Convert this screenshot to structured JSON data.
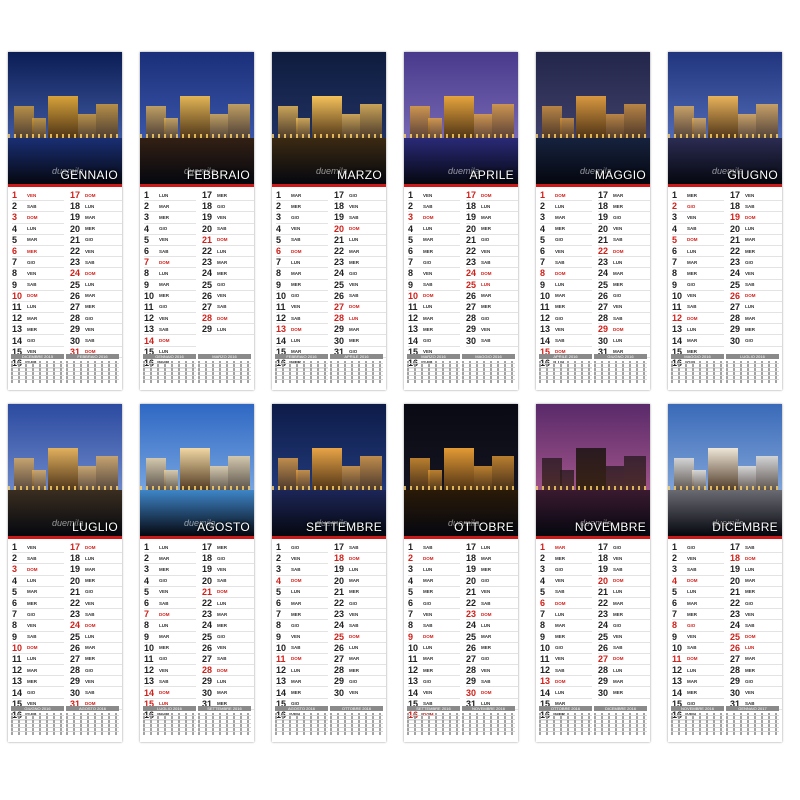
{
  "brand": "duemila",
  "months": [
    {
      "name": "GENNAIO",
      "sky": [
        "#0b1d55",
        "#5a78c6"
      ],
      "water": "#1a2f74",
      "tower": "#d8a23a",
      "mini": [
        "DICEMBRE 2015",
        "FEBBRAIO 2016"
      ],
      "days": [
        "VEN",
        "SAB",
        "DOM",
        "LUN",
        "MAR",
        "MER",
        "GIO",
        "VEN",
        "SAB",
        "DOM",
        "LUN",
        "MAR",
        "MER",
        "GIO",
        "VEN",
        "SAB",
        "DOM",
        "LUN",
        "MAR",
        "MER",
        "GIO",
        "VEN",
        "SAB",
        "DOM",
        "LUN",
        "MAR",
        "MER",
        "GIO",
        "VEN",
        "SAB",
        "DOM"
      ],
      "hol": [
        1,
        3,
        6,
        10,
        17,
        24,
        31
      ]
    },
    {
      "name": "FEBBRAIO",
      "sky": [
        "#1b2f7a",
        "#4a6ac0"
      ],
      "water": "#332014",
      "tower": "#e2b456",
      "mini": [
        "GENNAIO 2016",
        "MARZO 2016"
      ],
      "days": [
        "LUN",
        "MAR",
        "MER",
        "GIO",
        "VEN",
        "SAB",
        "DOM",
        "LUN",
        "MAR",
        "MER",
        "GIO",
        "VEN",
        "SAB",
        "DOM",
        "LUN",
        "MAR",
        "MER",
        "GIO",
        "VEN",
        "SAB",
        "DOM",
        "LUN",
        "MAR",
        "MER",
        "GIO",
        "VEN",
        "SAB",
        "DOM",
        "LUN"
      ],
      "hol": [
        7,
        14,
        21,
        28
      ]
    },
    {
      "name": "MARZO",
      "sky": [
        "#0e1c3e",
        "#2a3d74"
      ],
      "water": "#3b2a12",
      "tower": "#f4c15a",
      "mini": [
        "FEBBRAIO 2016",
        "APRILE 2016"
      ],
      "days": [
        "MAR",
        "MER",
        "GIO",
        "VEN",
        "SAB",
        "DOM",
        "LUN",
        "MAR",
        "MER",
        "GIO",
        "VEN",
        "SAB",
        "DOM",
        "LUN",
        "MAR",
        "MER",
        "GIO",
        "VEN",
        "SAB",
        "DOM",
        "LUN",
        "MAR",
        "MER",
        "GIO",
        "VEN",
        "SAB",
        "DOM",
        "LUN",
        "MAR",
        "MER",
        "GIO"
      ],
      "hol": [
        6,
        13,
        20,
        27,
        28
      ]
    },
    {
      "name": "APRILE",
      "sky": [
        "#4a3a8c",
        "#8d7fc8"
      ],
      "water": "#2a2a78",
      "tower": "#e6a43c",
      "mini": [
        "MARZO 2016",
        "MAGGIO 2016"
      ],
      "days": [
        "VEN",
        "SAB",
        "DOM",
        "LUN",
        "MAR",
        "MER",
        "GIO",
        "VEN",
        "SAB",
        "DOM",
        "LUN",
        "MAR",
        "MER",
        "GIO",
        "VEN",
        "SAB",
        "DOM",
        "LUN",
        "MAR",
        "MER",
        "GIO",
        "VEN",
        "SAB",
        "DOM",
        "LUN",
        "MAR",
        "MER",
        "GIO",
        "VEN",
        "SAB"
      ],
      "hol": [
        3,
        10,
        17,
        24,
        25
      ]
    },
    {
      "name": "MAGGIO",
      "sky": [
        "#23264a",
        "#4e4e7a"
      ],
      "water": "#16223e",
      "tower": "#d89840",
      "mini": [
        "APRILE 2016",
        "GIUGNO 2016"
      ],
      "days": [
        "DOM",
        "LUN",
        "MAR",
        "MER",
        "GIO",
        "VEN",
        "SAB",
        "DOM",
        "LUN",
        "MAR",
        "MER",
        "GIO",
        "VEN",
        "SAB",
        "DOM",
        "LUN",
        "MAR",
        "MER",
        "GIO",
        "VEN",
        "SAB",
        "DOM",
        "LUN",
        "MAR",
        "MER",
        "GIO",
        "VEN",
        "SAB",
        "DOM",
        "LUN",
        "MAR"
      ],
      "hol": [
        1,
        8,
        15,
        22,
        29
      ]
    },
    {
      "name": "GIUGNO",
      "sky": [
        "#20357e",
        "#6b86d0"
      ],
      "water": "#2b2c52",
      "tower": "#e8b25a",
      "mini": [
        "MAGGIO 2016",
        "LUGLIO 2016"
      ],
      "days": [
        "MER",
        "GIO",
        "VEN",
        "SAB",
        "DOM",
        "LUN",
        "MAR",
        "MER",
        "GIO",
        "VEN",
        "SAB",
        "DOM",
        "LUN",
        "MAR",
        "MER",
        "GIO",
        "VEN",
        "SAB",
        "DOM",
        "LUN",
        "MAR",
        "MER",
        "GIO",
        "VEN",
        "SAB",
        "DOM",
        "LUN",
        "MAR",
        "MER",
        "GIO"
      ],
      "hol": [
        2,
        5,
        12,
        19,
        26
      ]
    },
    {
      "name": "LUGLIO",
      "sky": [
        "#2c4aa0",
        "#8ea8de"
      ],
      "water": "#3a2e20",
      "tower": "#e2b05e",
      "mini": [
        "GIUGNO 2016",
        "AGOSTO 2016"
      ],
      "days": [
        "VEN",
        "SAB",
        "DOM",
        "LUN",
        "MAR",
        "MER",
        "GIO",
        "VEN",
        "SAB",
        "DOM",
        "LUN",
        "MAR",
        "MER",
        "GIO",
        "VEN",
        "SAB",
        "DOM",
        "LUN",
        "MAR",
        "MER",
        "GIO",
        "VEN",
        "SAB",
        "DOM",
        "LUN",
        "MAR",
        "MER",
        "GIO",
        "VEN",
        "SAB",
        "DOM"
      ],
      "hol": [
        3,
        10,
        17,
        24,
        31
      ]
    },
    {
      "name": "AGOSTO",
      "sky": [
        "#2f68c4",
        "#9cc4ee"
      ],
      "water": "#3e86c8",
      "tower": "#f1d7a4",
      "mini": [
        "LUGLIO 2016",
        "SETTEMBRE 2016"
      ],
      "days": [
        "LUN",
        "MAR",
        "MER",
        "GIO",
        "VEN",
        "SAB",
        "DOM",
        "LUN",
        "MAR",
        "MER",
        "GIO",
        "VEN",
        "SAB",
        "DOM",
        "LUN",
        "MAR",
        "MER",
        "GIO",
        "VEN",
        "SAB",
        "DOM",
        "LUN",
        "MAR",
        "MER",
        "GIO",
        "VEN",
        "SAB",
        "DOM",
        "LUN",
        "MAR",
        "MER"
      ],
      "hol": [
        7,
        14,
        15,
        21,
        28
      ]
    },
    {
      "name": "SETTEMBRE",
      "sky": [
        "#0d1b48",
        "#2d4a94"
      ],
      "water": "#1c2658",
      "tower": "#e8a446",
      "mini": [
        "AGOSTO 2016",
        "OTTOBRE 2016"
      ],
      "days": [
        "GIO",
        "VEN",
        "SAB",
        "DOM",
        "LUN",
        "MAR",
        "MER",
        "GIO",
        "VEN",
        "SAB",
        "DOM",
        "LUN",
        "MAR",
        "MER",
        "GIO",
        "VEN",
        "SAB",
        "DOM",
        "LUN",
        "MAR",
        "MER",
        "GIO",
        "VEN",
        "SAB",
        "DOM",
        "LUN",
        "MAR",
        "MER",
        "GIO",
        "VEN"
      ],
      "hol": [
        4,
        11,
        18,
        25
      ]
    },
    {
      "name": "OTTOBRE",
      "sky": [
        "#0a0a14",
        "#1a1a28"
      ],
      "water": "#2a1a08",
      "tower": "#e39a34",
      "mini": [
        "SETTEMBRE 2016",
        "NOVEMBRE 2016"
      ],
      "days": [
        "SAB",
        "DOM",
        "LUN",
        "MAR",
        "MER",
        "GIO",
        "VEN",
        "SAB",
        "DOM",
        "LUN",
        "MAR",
        "MER",
        "GIO",
        "VEN",
        "SAB",
        "DOM",
        "LUN",
        "MAR",
        "MER",
        "GIO",
        "VEN",
        "SAB",
        "DOM",
        "LUN",
        "MAR",
        "MER",
        "GIO",
        "VEN",
        "SAB",
        "DOM",
        "LUN"
      ],
      "hol": [
        2,
        9,
        16,
        23,
        30
      ]
    },
    {
      "name": "NOVEMBRE",
      "sky": [
        "#5a2a6a",
        "#c46a9a"
      ],
      "water": "#3a1a30",
      "tower": "#2a1a22",
      "mini": [
        "OTTOBRE 2016",
        "DICEMBRE 2016"
      ],
      "days": [
        "MAR",
        "MER",
        "GIO",
        "VEN",
        "SAB",
        "DOM",
        "LUN",
        "MAR",
        "MER",
        "GIO",
        "VEN",
        "SAB",
        "DOM",
        "LUN",
        "MAR",
        "MER",
        "GIO",
        "VEN",
        "SAB",
        "DOM",
        "LUN",
        "MAR",
        "MER",
        "GIO",
        "VEN",
        "SAB",
        "DOM",
        "LUN",
        "MAR",
        "MER"
      ],
      "hol": [
        1,
        6,
        13,
        20,
        27
      ]
    },
    {
      "name": "DICEMBRE",
      "sky": [
        "#3a6ab8",
        "#a4c2e8"
      ],
      "water": "#6a6a72",
      "tower": "#efe6d8",
      "mini": [
        "NOVEMBRE 2016",
        "GENNAIO 2017"
      ],
      "days": [
        "GIO",
        "VEN",
        "SAB",
        "DOM",
        "LUN",
        "MAR",
        "MER",
        "GIO",
        "VEN",
        "SAB",
        "DOM",
        "LUN",
        "MAR",
        "MER",
        "GIO",
        "VEN",
        "SAB",
        "DOM",
        "LUN",
        "MAR",
        "MER",
        "GIO",
        "VEN",
        "SAB",
        "DOM",
        "LUN",
        "MAR",
        "MER",
        "GIO",
        "VEN",
        "SAB"
      ],
      "hol": [
        4,
        8,
        11,
        18,
        25,
        26
      ]
    }
  ]
}
